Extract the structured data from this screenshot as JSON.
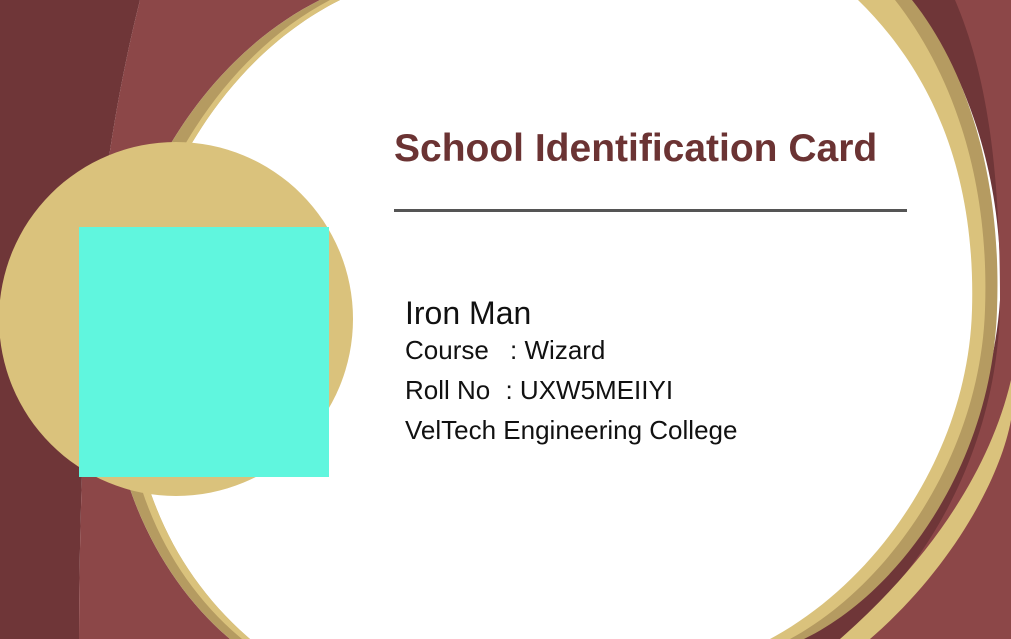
{
  "card": {
    "title": "School Identification Card",
    "name": "Iron Man",
    "course_label": "Course",
    "course_sep": " : ",
    "course_value": "Wizard",
    "roll_label": "Roll No",
    "roll_sep": " : ",
    "roll_value": "UXW5MEIIYI",
    "college": "VelTech Engineering College"
  },
  "colors": {
    "title": "#6b3333",
    "maroon_dark": "#6f3638",
    "maroon_light": "#8c4748",
    "gold": "#dac27c",
    "gold_dark": "#b59b61",
    "photo": "#60f6de",
    "divider": "#555555",
    "text": "#111111"
  }
}
